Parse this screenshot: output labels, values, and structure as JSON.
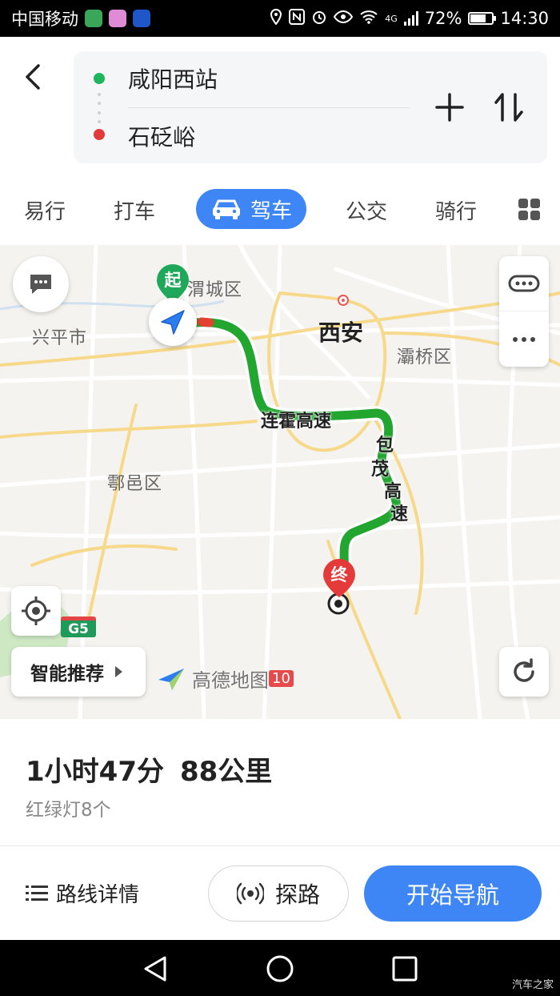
{
  "status_bar": {
    "carrier": "中国移动",
    "network": "4G",
    "battery": "72%",
    "battery_level": 0.72,
    "time": "14:30"
  },
  "route": {
    "origin": "咸阳西站",
    "destination": "石砭峪"
  },
  "modes": [
    {
      "label": "易行",
      "active": false
    },
    {
      "label": "打车",
      "active": false
    },
    {
      "label": "驾车",
      "active": true
    },
    {
      "label": "公交",
      "active": false
    },
    {
      "label": "骑行",
      "active": false
    }
  ],
  "map": {
    "start_marker": "起",
    "end_marker": "终",
    "labels": {
      "weicheng": "渭城区",
      "xingping": "兴平市",
      "xian": "西安",
      "baqiao": "灞桥区",
      "huyi": "鄠邑区"
    },
    "road_labels": {
      "lianhuo": "连霍高速",
      "baomao_1": "包",
      "baomao_2": "茂",
      "baomao_3": "高",
      "baomao_4": "速"
    },
    "highway_badge": "G5",
    "recommend_label": "智能推荐",
    "brand_name": "高德地图",
    "brand_badge": "10",
    "route_color": "#22a630"
  },
  "summary": {
    "duration": "1小时47分",
    "distance": "88公里",
    "traffic_lights": "红绿灯8个"
  },
  "actions": {
    "details": "路线详情",
    "probe": "探路",
    "start": "开始导航"
  },
  "colors": {
    "accent": "#3e86f6",
    "origin_dot": "#1fb55c",
    "destination_dot": "#e03a3a"
  },
  "watermark": "汽车之家"
}
